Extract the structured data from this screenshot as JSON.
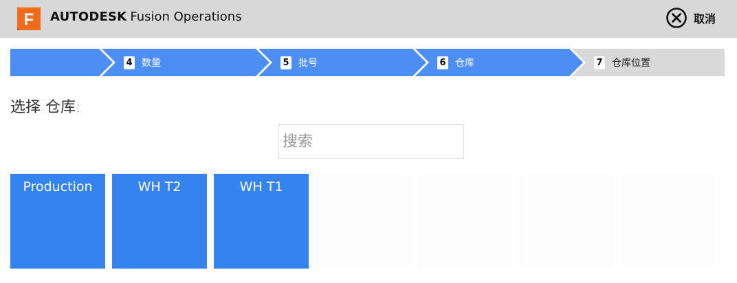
{
  "header": {
    "logo_letter": "F",
    "brand_bold": "AUTODESK",
    "brand_product": "Fusion Operations",
    "cancel_label": "取消",
    "cancel_icon": "close-circle-icon"
  },
  "colors": {
    "header_bg": "#d8d8d8",
    "step_active": "#4d8ef5",
    "step_inactive": "#d9d9d9",
    "tile_blue": "#3583f0",
    "logo_orange": "#f26b1d"
  },
  "steps": [
    {
      "number": "",
      "label": "",
      "state": "done"
    },
    {
      "number": "4",
      "label": "数量",
      "state": "done"
    },
    {
      "number": "5",
      "label": "批号",
      "state": "done"
    },
    {
      "number": "6",
      "label": "仓库",
      "state": "current"
    },
    {
      "number": "7",
      "label": "仓库位置",
      "state": "pending"
    }
  ],
  "main": {
    "prompt": "选择 仓库:",
    "search_placeholder": "搜索",
    "search_value": ""
  },
  "warehouses": [
    {
      "name": "Production"
    },
    {
      "name": "WH T2"
    },
    {
      "name": "WH T1"
    },
    {
      "name": ""
    },
    {
      "name": ""
    },
    {
      "name": ""
    },
    {
      "name": ""
    }
  ]
}
